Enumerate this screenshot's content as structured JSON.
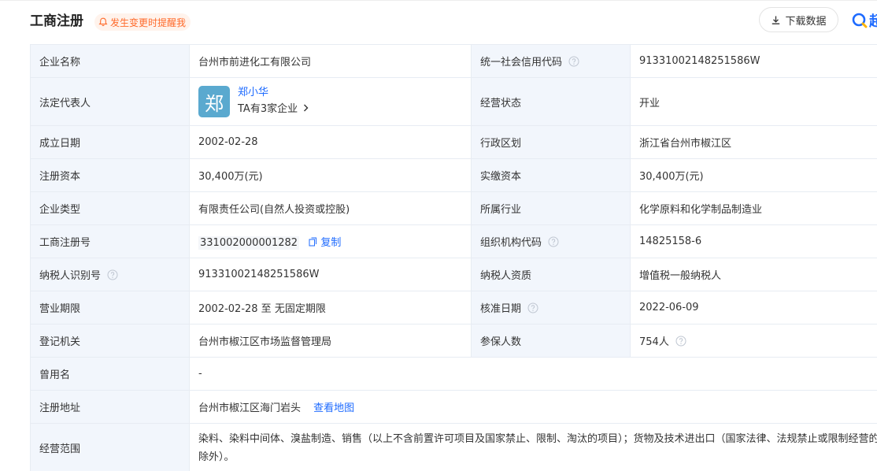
{
  "header": {
    "title": "工商注册",
    "alert_label": "发生变更时提醒我",
    "download_label": "下载数据",
    "logo_char": "超"
  },
  "company": {
    "name_label": "企业名称",
    "name": "台州市前进化工有限公司",
    "credit_code_label": "统一社会信用代码",
    "credit_code": "91331002148251586W",
    "legal_rep_label": "法定代表人",
    "legal_rep_avatar": "郑",
    "legal_rep_name": "郑小华",
    "legal_rep_companies": "TA有3家企业",
    "status_label": "经营状态",
    "status": "开业",
    "founded_label": "成立日期",
    "founded": "2002-02-28",
    "region_label": "行政区划",
    "region": "浙江省台州市椒江区",
    "reg_capital_label": "注册资本",
    "reg_capital": "30,400万(元)",
    "paid_capital_label": "实缴资本",
    "paid_capital": "30,400万(元)",
    "type_label": "企业类型",
    "type": "有限责任公司(自然人投资或控股)",
    "industry_label": "所属行业",
    "industry": "化学原料和化学制品制造业",
    "reg_no_label": "工商注册号",
    "reg_no": "331002000001282",
    "copy_label": "复制",
    "org_code_label": "组织机构代码",
    "org_code": "14825158-6",
    "taxpayer_id_label": "纳税人识别号",
    "taxpayer_id": "91331002148251586W",
    "taxpayer_qual_label": "纳税人资质",
    "taxpayer_qual": "增值税一般纳税人",
    "term_label": "营业期限",
    "term": "2002-02-28 至 无固定期限",
    "approval_date_label": "核准日期",
    "approval_date": "2022-06-09",
    "authority_label": "登记机关",
    "authority": "台州市椒江区市场监督管理局",
    "insured_label": "参保人数",
    "insured": "754人",
    "former_name_label": "曾用名",
    "former_name": "-",
    "address_label": "注册地址",
    "address": "台州市椒江区海门岩头",
    "map_link": "查看地图",
    "scope_label": "经营范围",
    "scope": "染料、染料中间体、溴盐制造、销售（以上不含前置许可项目及国家禁止、限制、淘汰的项目）；货物及技术进出口（国家法律、法规禁止或限制经营的项目除外）。"
  },
  "colors": {
    "label_bg": "#f2f6fc",
    "border": "#e7ecf3",
    "link": "#1e6bff",
    "alert": "#ff6a2a",
    "avatar_bg": "#5aa9cf"
  }
}
